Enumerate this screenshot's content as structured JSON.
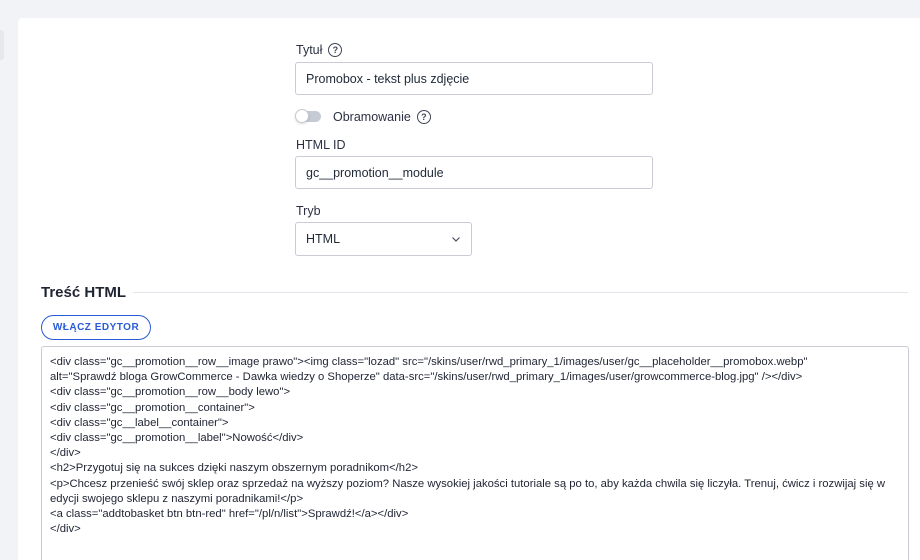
{
  "form": {
    "title_label": "Tytuł",
    "title_value": "Promobox - tekst plus zdjęcie",
    "border_label": "Obramowanie",
    "border_enabled": false,
    "html_id_label": "HTML ID",
    "html_id_value": "gc__promotion__module",
    "mode_label": "Tryb",
    "mode_value": "HTML"
  },
  "section": {
    "title": "Treść HTML",
    "editor_button": "WŁĄCZ EDYTOR"
  },
  "code": {
    "content": "<div class=\"gc__promotion__row__image prawo\"><img class=\"lozad\" src=\"/skins/user/rwd_primary_1/images/user/gc__placeholder__promobox.webp\"\nalt=\"Sprawdź bloga GrowCommerce - Dawka wiedzy o Shoperze\" data-src=\"/skins/user/rwd_primary_1/images/user/growcommerce-blog.jpg\" /></div>\n<div class=\"gc__promotion__row__body lewo\">\n<div class=\"gc__promotion__container\">\n<div class=\"gc__label__container\">\n<div class=\"gc__promotion__label\">Nowość</div>\n</div>\n<h2>Przygotuj się na sukces dzięki naszym obszernym poradnikom</h2>\n<p>Chcesz przenieść swój sklep oraz sprzedaż na wyższy poziom? Nasze wysokiej jakości tutoriale są po to, aby każda chwila się liczyła. Trenuj, ćwicz i rozwijaj się w\nedycji swojego sklepu z naszymi poradnikami!</p>\n<a class=\"addtobasket btn btn-red\" href=\"/pl/n/list\">Sprawdź!</a></div>\n</div>"
  },
  "icons": {
    "help": "question-circle-icon",
    "select": "chevron-down-icon"
  },
  "colors": {
    "accent": "#2a5bd7",
    "toggle_off": "#c5cad5"
  }
}
